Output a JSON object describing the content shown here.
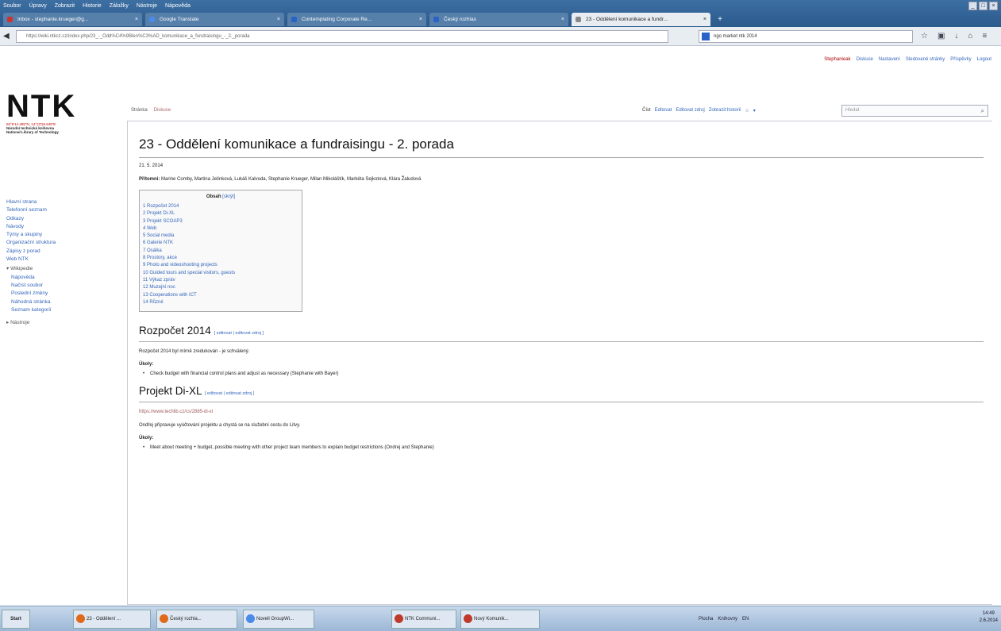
{
  "browser": {
    "menu": [
      "Soubor",
      "Úpravy",
      "Zobrazit",
      "Historie",
      "Záložky",
      "Nástroje",
      "Nápověda"
    ],
    "tabs": [
      {
        "label": "Inbox - stephanie.krueger@g...",
        "color": "#c33",
        "active": false
      },
      {
        "label": "Google Translate",
        "color": "#4a8ae8",
        "active": false
      },
      {
        "label": "Contemplating Corporate Re...",
        "color": "#2a62c8",
        "active": false
      },
      {
        "label": "Český rozhlas",
        "color": "#2a62c8",
        "active": false
      },
      {
        "label": "23 - Oddělení komunikace a fundr...",
        "color": "#888",
        "active": true
      }
    ],
    "url": "https://wiki.ntkcz.cz/index.php/23_-_Odd%C4%9Blen%C3%AD_komunikace_a_fundraisingu_-_2._porada",
    "search_value": "ngo market ntk 2014"
  },
  "personal": {
    "user": "Stephanieak",
    "items": [
      "Diskuse",
      "Nastavení",
      "Sledované stránky",
      "Příspěvky",
      "Logout"
    ]
  },
  "logo": {
    "name": "NTK",
    "coords": "50°6'14.485\"N, 14°23'26.645\"E",
    "line1": "Národní technická knihovna",
    "line2": "National Library of Technology"
  },
  "sidebar": {
    "items": [
      "Hlavní strana",
      "Telefonní seznam",
      "Odkazy",
      "Návody",
      "Týmy a skupiny",
      "Organizační struktura",
      "Zápisy z porad",
      "Web NTK"
    ],
    "wikipedie": "Wikipedie",
    "wiki_items": [
      "Nápověda",
      "Načíst soubor",
      "Poslední změny",
      "Náhodná stránka",
      "Seznam kategorií"
    ],
    "nastroje": "Nástroje"
  },
  "content_tabs": [
    "Stránka",
    "Diskuse"
  ],
  "view_tabs": [
    "Číst",
    "Editovat",
    "Editovat zdroj",
    "Zobrazit historii"
  ],
  "wiki_search_placeholder": "Hledat",
  "page": {
    "title": "23 - Oddělení komunikace a fundraisingu - 2. porada",
    "date": "21. 5. 2014",
    "present_label": "Přítomni:",
    "present": "Marine Comby, Martina Jelínková, Lukáš Kalvoda, Stephanie Krueger, Milan Mikoláštík, Markéta Sejkotová, Klára Žaludová",
    "toc_title": "Obsah",
    "toc_toggle": "[skrýt]",
    "toc": [
      "1 Rozpočet 2014",
      "2 Projekt Di-XL",
      "3 Projekt SCOAP3",
      "4 Web",
      "5 Social media",
      "6 Galerie NTK",
      "7 Osálka",
      "8 Prostory, akce",
      "9 Photo and videoshooting projects",
      "10 Guided tours and special visitors, guests",
      "11 Výkaz zpráv",
      "12 Muzejní noc",
      "13 Cooperations with ICT",
      "14 Různé"
    ],
    "edit_links": "[ editovat | editovat zdroj ]",
    "sections": [
      {
        "title": "Rozpočet 2014",
        "text": "Rozpočet 2014 byl mírně zredukován - je schválený.",
        "tasks": "Úkoly:",
        "bullet": "Check budget with financial control plans and adjust as necessary (Stephanie with Bayer)"
      },
      {
        "title": "Projekt Di-XL",
        "link": "https://www.techlib.cz/cs/2885-di-xl",
        "text": "Ondřej připravuje vyúčtování projektu a chystá se na služební cestu do Litvy.",
        "tasks": "Úkoly:",
        "bullet": "Meet about meeting + budget, possible meeting with other project team members to explain budget restrictions (Ondrej and Stephanie)"
      }
    ]
  },
  "taskbar": {
    "start": "Start",
    "items": [
      {
        "label": "23 - Oddělení ...",
        "color": "#e06a1c"
      },
      {
        "label": "Český rozhla...",
        "color": "#e06a1c"
      },
      {
        "label": "Novell GroupWi...",
        "color": "#4a8ae8"
      },
      {
        "label": "NTK Communi...",
        "color": "#c03a2b"
      },
      {
        "label": "Nový Komunik...",
        "color": "#c03a2b"
      }
    ],
    "tray": [
      "Plocha",
      "Knihovny",
      "EN"
    ],
    "time": "14:49",
    "date": "2.6.2014"
  }
}
